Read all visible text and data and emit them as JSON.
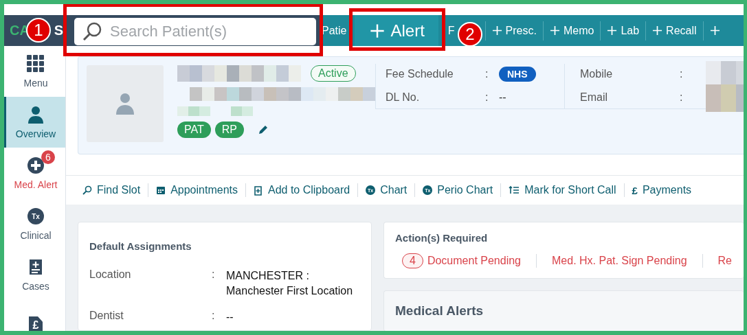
{
  "logo_parts": [
    "CA",
    "S"
  ],
  "search": {
    "placeholder": "Search Patient(s)"
  },
  "nav": [
    {
      "label": "Patie",
      "kind": "text",
      "highlighted": false
    },
    {
      "label": "Alert",
      "kind": "plus",
      "highlighted": true
    },
    {
      "label": "F",
      "kind": "text",
      "highlighted": false
    },
    {
      "label": "Presc.",
      "kind": "plus",
      "highlighted": false
    },
    {
      "label": "Memo",
      "kind": "plus",
      "highlighted": false
    },
    {
      "label": "Lab",
      "kind": "plus",
      "highlighted": false
    },
    {
      "label": "Recall",
      "kind": "plus",
      "highlighted": false
    },
    {
      "kind": "plus_only",
      "highlighted": false
    }
  ],
  "callouts": [
    {
      "number": "1"
    },
    {
      "number": "2"
    }
  ],
  "sidebar": [
    {
      "label": "Menu",
      "kind": "grid",
      "selected": false,
      "alert": false
    },
    {
      "label": "Overview",
      "kind": "person",
      "selected": true,
      "alert": false
    },
    {
      "label": "Med. Alert",
      "kind": "plus",
      "selected": false,
      "alert": true,
      "badge": "6"
    },
    {
      "label": "Clinical",
      "kind": "tx",
      "icon_text": "Tx",
      "selected": false,
      "alert": false
    },
    {
      "label": "Cases",
      "kind": "cases",
      "selected": false,
      "alert": false
    },
    {
      "kind": "pound",
      "icon_text": "£",
      "selected": false,
      "alert": false
    }
  ],
  "patient": {
    "name_redacted": true,
    "status": "Active",
    "address_redacted": true,
    "tags": [
      "PAT",
      "RP"
    ],
    "fields": [
      {
        "label": "Fee Schedule",
        "sep": ":",
        "value": "NHS",
        "kind": "pill"
      },
      {
        "label": "DL No.",
        "sep": ":",
        "value": "--",
        "kind": "text"
      },
      {
        "label": "Mobile",
        "sep": ":",
        "kind": "redacted"
      },
      {
        "label": "Email",
        "sep": ":",
        "kind": "redacted"
      }
    ]
  },
  "actions": [
    {
      "label": "Find Slot",
      "kind": "search"
    },
    {
      "label": "Appointments",
      "kind": "calendar"
    },
    {
      "label": "Add to Clipboard",
      "kind": "clipboard"
    },
    {
      "label": "Chart",
      "kind": "tx",
      "icon_text": "Tx"
    },
    {
      "label": "Perio Chart",
      "kind": "tx",
      "icon_text": "Tx"
    },
    {
      "label": "Mark for Short Call",
      "kind": "list"
    },
    {
      "label": "Payments",
      "kind": "glyph",
      "icon_text": "£"
    }
  ],
  "assignments": {
    "title": "Default Assignments",
    "rows": [
      {
        "label": "Location",
        "sep": ":",
        "value": "MANCHESTER :\nManchester First Location"
      },
      {
        "label": "Dentist",
        "sep": ":",
        "value": "--"
      }
    ]
  },
  "actions_required": {
    "title": "Action(s) Required",
    "items": [
      {
        "count": "4",
        "label": "Document Pending"
      },
      {
        "label": "Med. Hx. Pat. Sign Pending"
      },
      {
        "label": "Re"
      }
    ]
  },
  "medical_alerts": {
    "title": "Medical Alerts"
  }
}
